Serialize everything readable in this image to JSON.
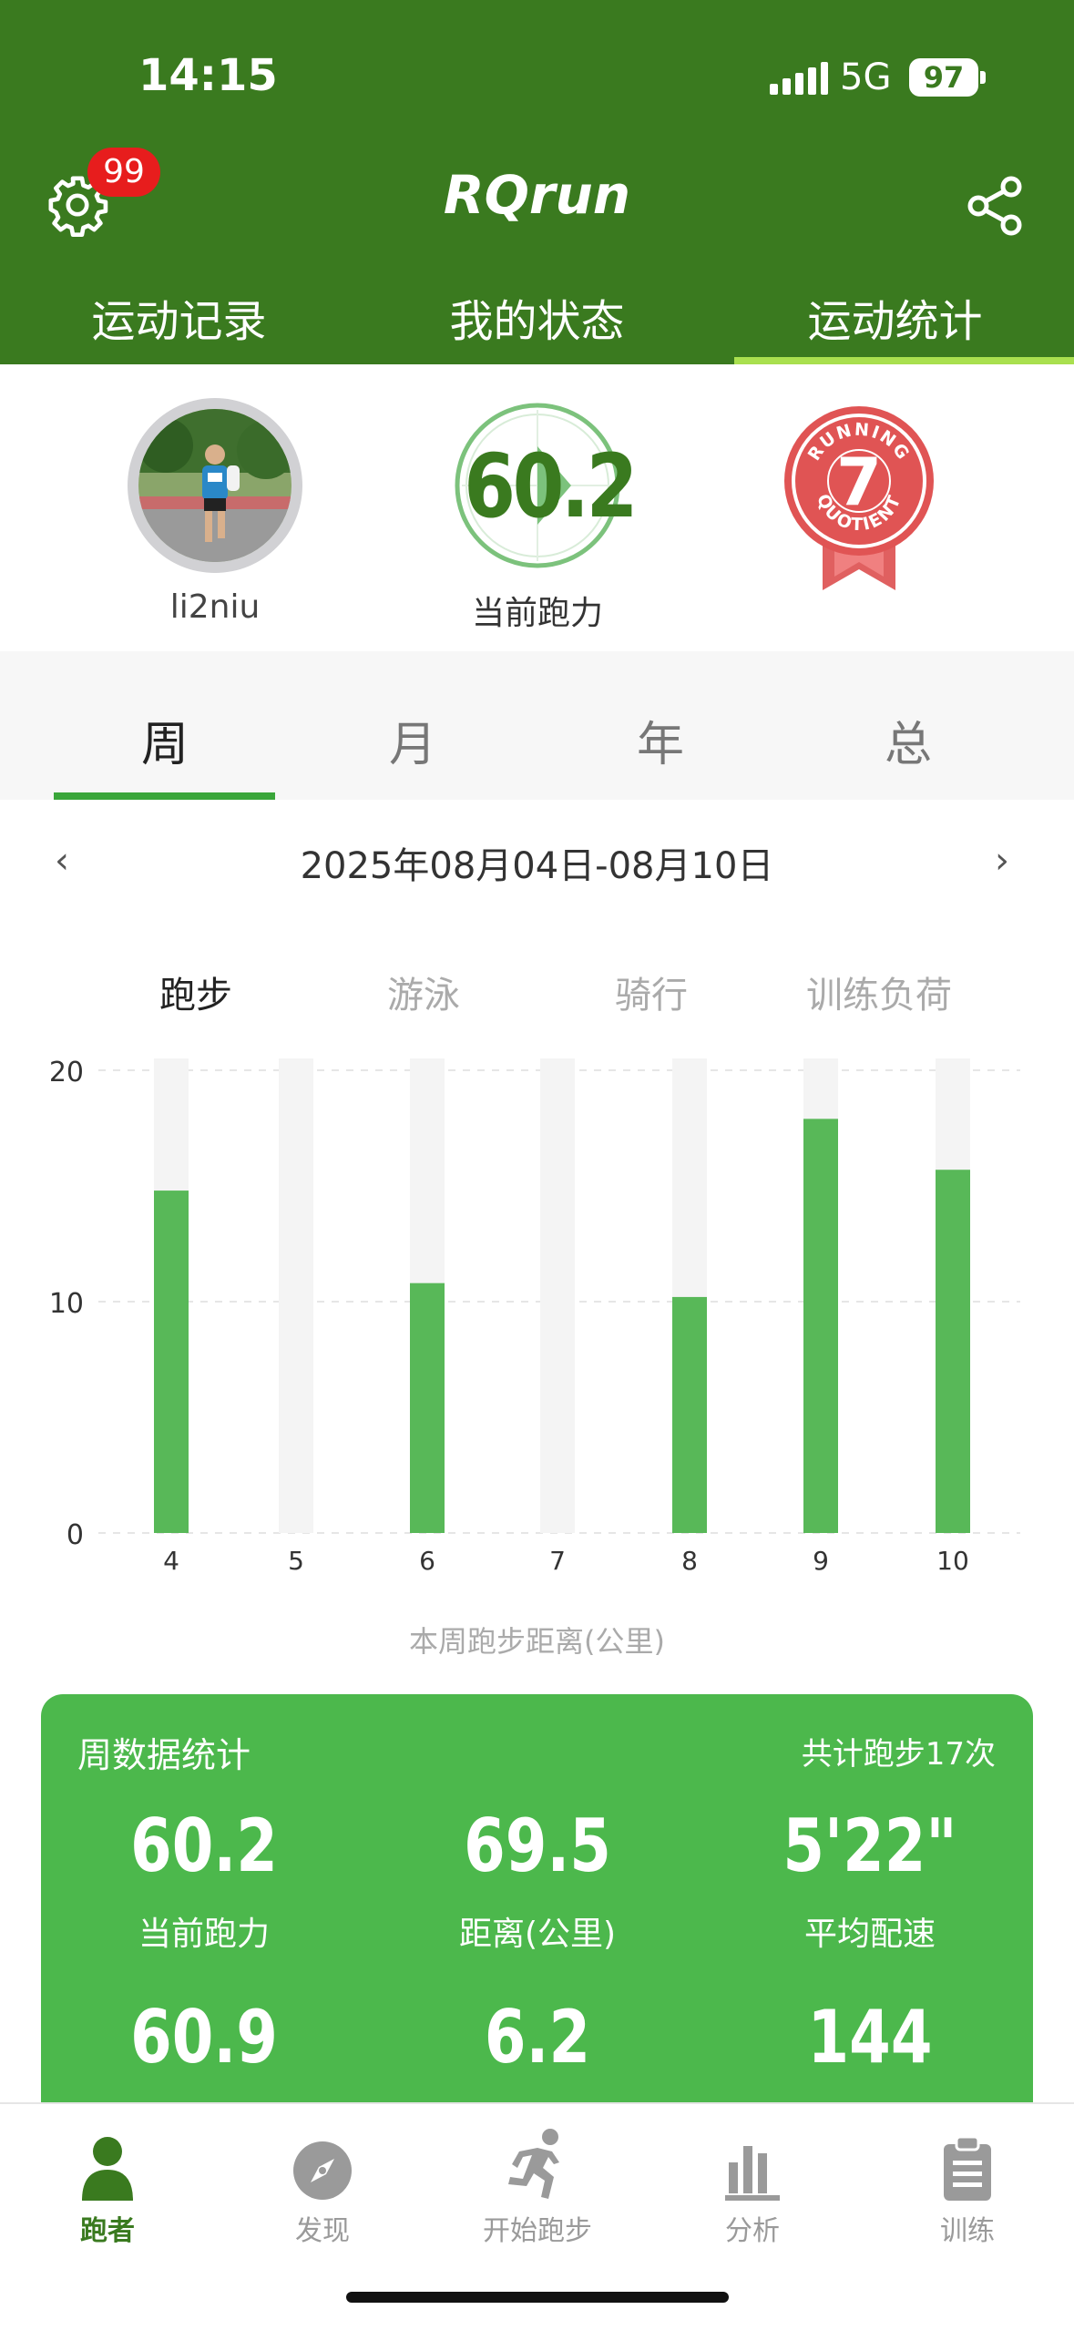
{
  "status_bar": {
    "time": "14:15",
    "network": "5G",
    "battery": "97"
  },
  "header": {
    "title": "RQrun",
    "badge": "99"
  },
  "top_tabs": [
    {
      "label": "运动记录"
    },
    {
      "label": "我的状态"
    },
    {
      "label": "运动统计"
    }
  ],
  "profile": {
    "username": "li2niu",
    "power_value": "60.2",
    "power_label": "当前跑力",
    "rq_number": "7",
    "rq_text": "RUNNING QUOTIENT"
  },
  "period_tabs": [
    {
      "label": "周"
    },
    {
      "label": "月"
    },
    {
      "label": "年"
    },
    {
      "label": "总"
    }
  ],
  "date_range": "2025年08月04日-08月10日",
  "sport_tabs": [
    {
      "label": "跑步"
    },
    {
      "label": "游泳"
    },
    {
      "label": "骑行"
    },
    {
      "label": "训练负荷"
    }
  ],
  "chart_data": {
    "type": "bar",
    "categories": [
      "4",
      "5",
      "6",
      "7",
      "8",
      "9",
      "10"
    ],
    "values": [
      14.8,
      0,
      10.8,
      0,
      10.2,
      17.9,
      15.7
    ],
    "ylim": [
      0,
      20
    ],
    "yticks": [
      "0",
      "10",
      "20"
    ],
    "xlabel": "本周跑步距离(公里)",
    "colors": {
      "bar": "#58b858",
      "track": "#f4f4f4"
    }
  },
  "stats": {
    "title": "周数据统计",
    "total": "共计跑步17次",
    "row1": [
      {
        "value": "60.2",
        "label": "当前跑力"
      },
      {
        "value": "69.5",
        "label": "距离(公里)"
      },
      {
        "value": "5'22\"",
        "label": "平均配速"
      }
    ],
    "row2": [
      {
        "value": "60.9"
      },
      {
        "value": "6.2"
      },
      {
        "value": "144"
      }
    ]
  },
  "bottom_nav": [
    {
      "label": "跑者",
      "icon": "person-icon"
    },
    {
      "label": "发现",
      "icon": "compass-icon"
    },
    {
      "label": "开始跑步",
      "icon": "runner-icon"
    },
    {
      "label": "分析",
      "icon": "bar-chart-icon"
    },
    {
      "label": "训练",
      "icon": "clipboard-icon"
    }
  ],
  "colors": {
    "header": "#3a7a1f",
    "accent": "#4cb84c",
    "badge": "#e71d1d"
  }
}
